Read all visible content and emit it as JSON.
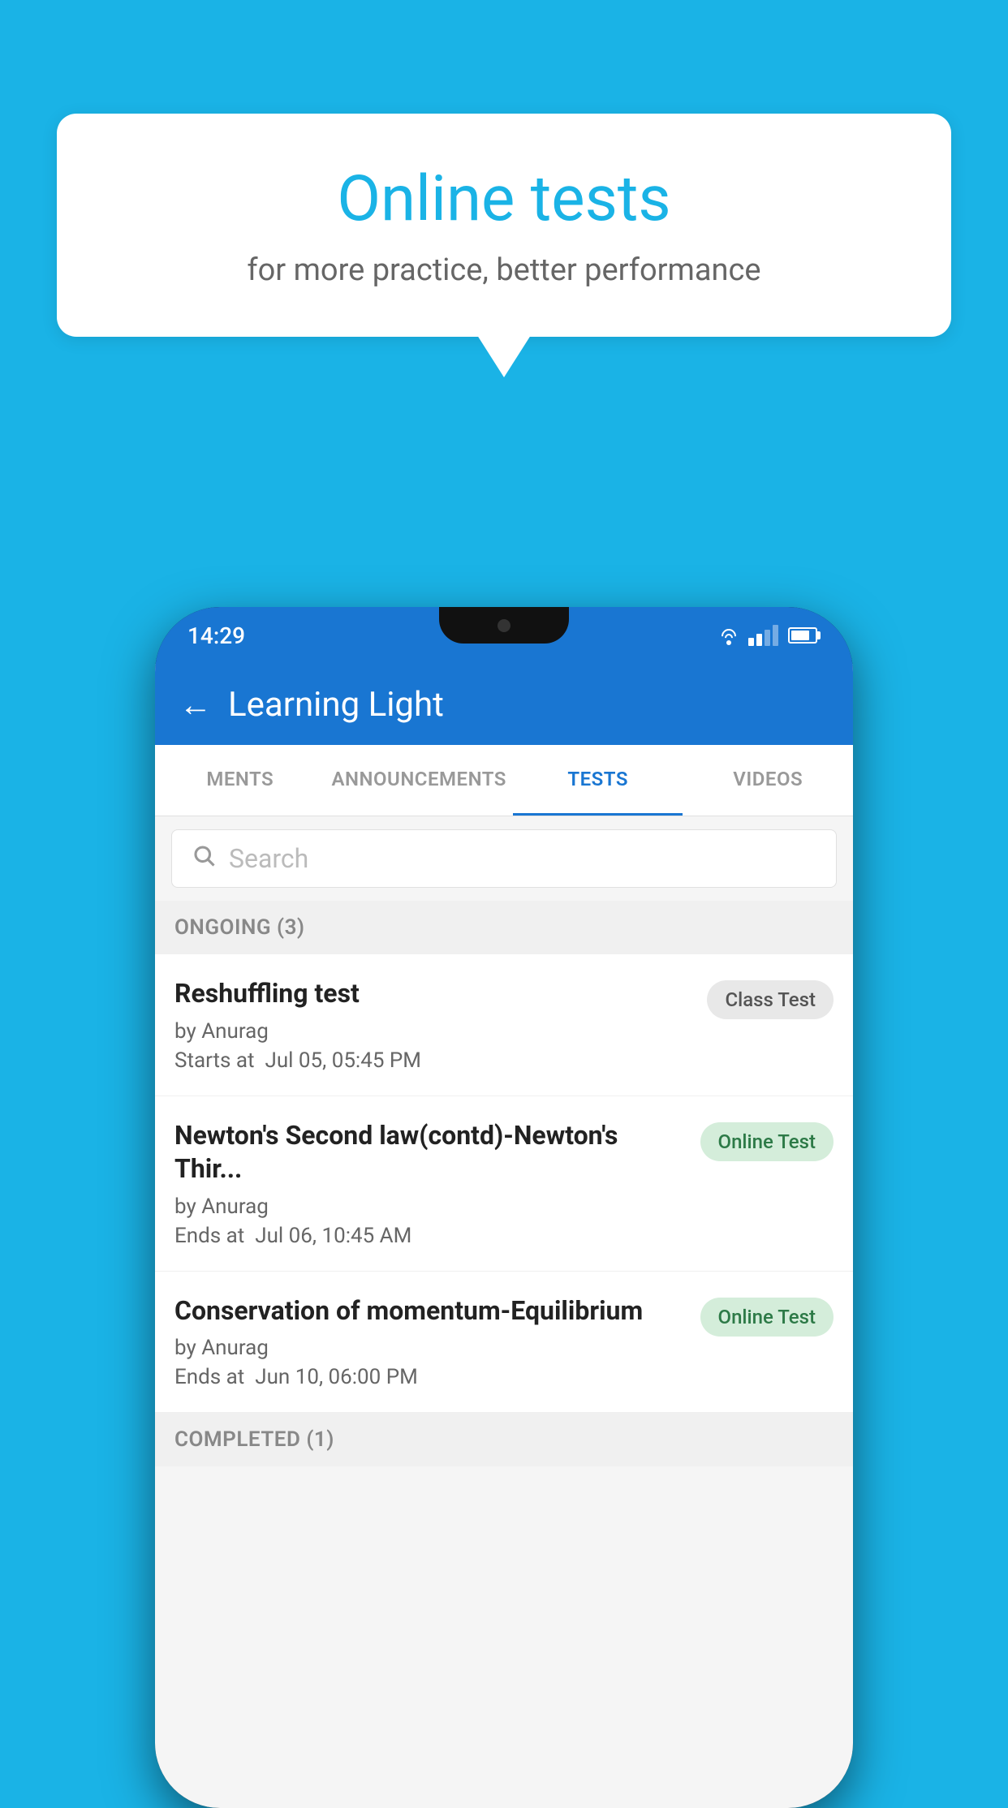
{
  "background": {
    "color": "#1ab3e6"
  },
  "speech_bubble": {
    "title": "Online tests",
    "subtitle": "for more practice, better performance"
  },
  "phone": {
    "status_bar": {
      "time": "14:29"
    },
    "header": {
      "back_label": "←",
      "title": "Learning Light"
    },
    "tabs": [
      {
        "label": "MENTS",
        "active": false
      },
      {
        "label": "ANNOUNCEMENTS",
        "active": false
      },
      {
        "label": "TESTS",
        "active": true
      },
      {
        "label": "VIDEOS",
        "active": false
      }
    ],
    "search": {
      "placeholder": "Search"
    },
    "sections": [
      {
        "title": "ONGOING (3)",
        "tests": [
          {
            "name": "Reshuffling test",
            "author": "by Anurag",
            "date_label": "Starts at",
            "date": "Jul 05, 05:45 PM",
            "badge": "Class Test",
            "badge_type": "class"
          },
          {
            "name": "Newton's Second law(contd)-Newton's Thir...",
            "author": "by Anurag",
            "date_label": "Ends at",
            "date": "Jul 06, 10:45 AM",
            "badge": "Online Test",
            "badge_type": "online"
          },
          {
            "name": "Conservation of momentum-Equilibrium",
            "author": "by Anurag",
            "date_label": "Ends at",
            "date": "Jun 10, 06:00 PM",
            "badge": "Online Test",
            "badge_type": "online"
          }
        ]
      },
      {
        "title": "COMPLETED (1)",
        "tests": []
      }
    ]
  }
}
